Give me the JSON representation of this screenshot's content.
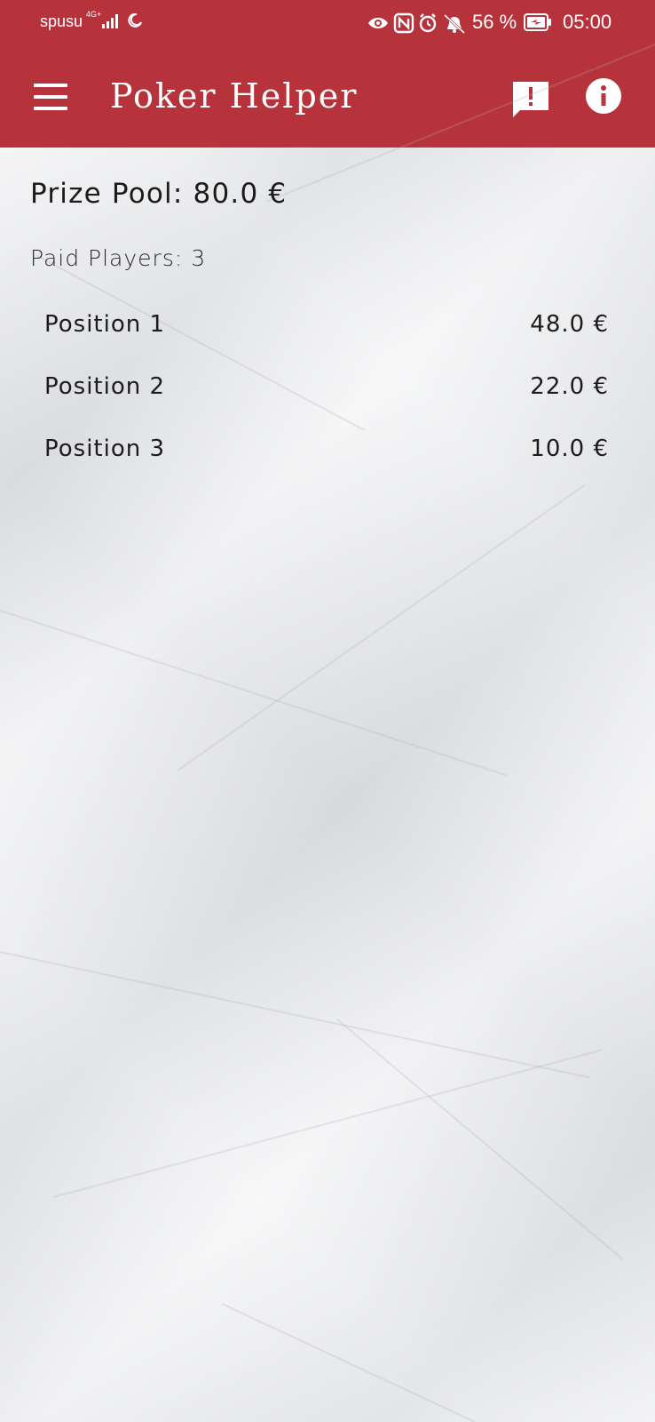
{
  "status_bar": {
    "carrier": "spusu",
    "network": "4G+",
    "battery_percent": "56 %",
    "time": "05:00",
    "icons": [
      "signal-bars-icon",
      "moon-icon",
      "eye-icon",
      "nfc-icon",
      "alarm-icon",
      "bell-off-icon",
      "battery-charging-icon"
    ]
  },
  "app_bar": {
    "title": "Poker Helper",
    "menu_icon": "hamburger-menu-icon",
    "feedback_icon": "feedback-icon",
    "info_icon": "info-icon"
  },
  "main": {
    "prize_pool": "Prize Pool: 80.0 €",
    "paid_players": "Paid Players: 3",
    "payouts": [
      {
        "label": "Position 1",
        "amount": "48.0 €"
      },
      {
        "label": "Position 2",
        "amount": "22.0 €"
      },
      {
        "label": "Position 3",
        "amount": "10.0 €"
      }
    ]
  },
  "colors": {
    "app_bar": "#b7333c",
    "text": "#1b1b1b",
    "paper": "#e6e7ea"
  }
}
